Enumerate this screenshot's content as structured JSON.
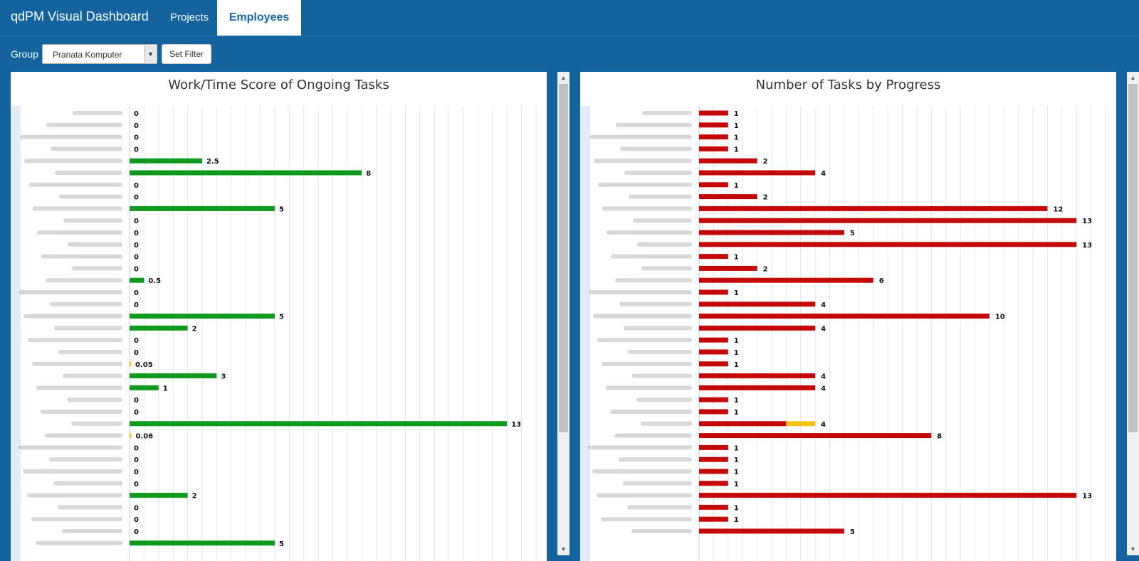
{
  "app": {
    "brand": "qdPM Visual Dashboard",
    "tabs": [
      {
        "label": "Projects",
        "active": false
      },
      {
        "label": "Employees",
        "active": true
      }
    ]
  },
  "filter": {
    "group_label": "Group",
    "group_value": "Pranata Komputer",
    "button_label": "Set Filter"
  },
  "colors": {
    "header_bg": "#12639e",
    "score_bar": "#0f9a1f",
    "score_low": "#f2c416",
    "progress_bar": "#c40808",
    "progress_partial": "#f5c218"
  },
  "chart_data": [
    {
      "type": "bar",
      "orientation": "horizontal",
      "title": "Work/Time Score of Ongoing Tasks",
      "xlim": [
        0,
        14
      ],
      "grid": true,
      "employee_names_legible": false,
      "values": [
        0,
        0,
        0,
        0,
        2.5,
        8,
        0,
        0,
        5,
        0,
        0,
        0,
        0,
        0,
        0.5,
        0,
        0,
        5,
        2,
        0,
        0,
        0.05,
        3,
        1,
        0,
        0,
        13,
        0.06,
        0,
        0,
        0,
        0,
        2,
        0,
        0,
        0,
        5
      ],
      "labels": [
        "0",
        "0",
        "0",
        "0",
        "2.5",
        "8",
        "0",
        "0",
        "5",
        "0",
        "0",
        "0",
        "0",
        "0",
        "0.5",
        "0",
        "0",
        "5",
        "2",
        "0",
        "0",
        "0.05",
        "3",
        "1",
        "0",
        "0",
        "13",
        "0.06",
        "0",
        "0",
        "0",
        "0",
        "2",
        "0",
        "0",
        "0",
        "5"
      ],
      "low_score_highlight": [
        21,
        27
      ]
    },
    {
      "type": "bar",
      "orientation": "horizontal",
      "stacked": true,
      "title": "Number of Tasks by Progress",
      "xlim": [
        0,
        14
      ],
      "grid": true,
      "employee_names_legible": false,
      "series": [
        {
          "values": [
            1,
            1,
            1,
            1,
            2,
            4,
            1,
            2,
            12,
            13,
            5,
            13,
            1,
            2,
            6,
            1,
            4,
            10,
            4,
            1,
            1,
            1,
            4,
            4,
            1,
            1,
            3,
            8,
            1,
            1,
            1,
            1,
            13,
            1,
            1,
            5
          ]
        },
        {
          "values": [
            0,
            0,
            0,
            0,
            0,
            0,
            0,
            0,
            0,
            0,
            0,
            0,
            0,
            0,
            0,
            0,
            0,
            0,
            0,
            0,
            0,
            0,
            0,
            0,
            0,
            0,
            1,
            0,
            0,
            0,
            0,
            0,
            0,
            0,
            0,
            0
          ]
        }
      ],
      "totals": [
        1,
        1,
        1,
        1,
        2,
        4,
        1,
        2,
        12,
        13,
        5,
        13,
        1,
        2,
        6,
        1,
        4,
        10,
        4,
        1,
        1,
        1,
        4,
        4,
        1,
        1,
        4,
        8,
        1,
        1,
        1,
        1,
        13,
        1,
        1,
        5
      ]
    }
  ]
}
